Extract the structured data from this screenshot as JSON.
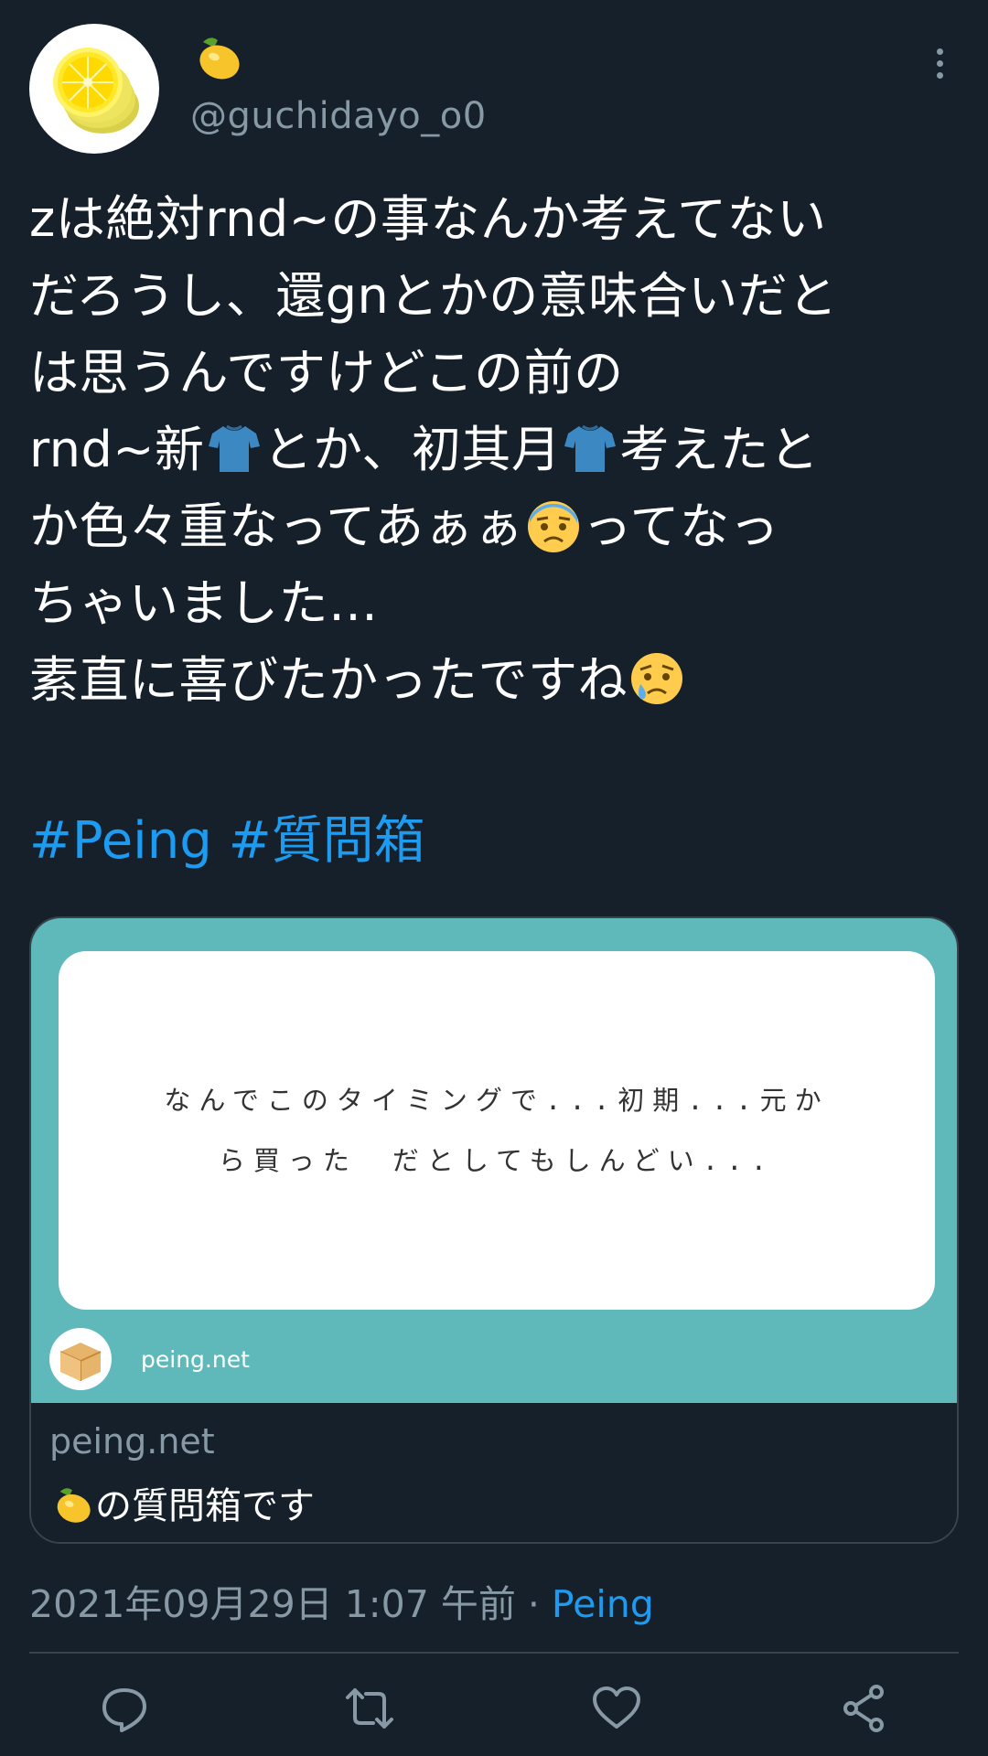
{
  "user": {
    "display_name_emoji": "lemon",
    "handle": "@guchidayo_o0",
    "avatar_icon": "lemon-slices-icon"
  },
  "tweet": {
    "lines": [
      "zは絶対rnd~の事なんか考えてない",
      "だろうし、還gnとかの意味合いだと",
      "は思うんですけどこの前の",
      "rnd~新",
      "とか、初其月",
      "考えたと",
      "か色々重なってあぁぁ",
      "ってなっ",
      "ちゃいました…",
      "素直に喜びたかったですね"
    ],
    "hashtags": [
      "#Peing",
      "#質問箱"
    ]
  },
  "card": {
    "question_line1": "なんでこのタイミングで...初期...元か",
    "question_line2": "ら買った　だとしてもしんどい...",
    "site_label": "peing.net",
    "domain": "peing.net",
    "description": "の質問箱です"
  },
  "meta": {
    "timestamp": "2021年09月29日 1:07 午前 · ",
    "source": "Peing"
  },
  "colors": {
    "background": "#15202b",
    "accent": "#1d9bf0",
    "muted": "#8899a6",
    "card_teal": "#5fb8b9"
  }
}
